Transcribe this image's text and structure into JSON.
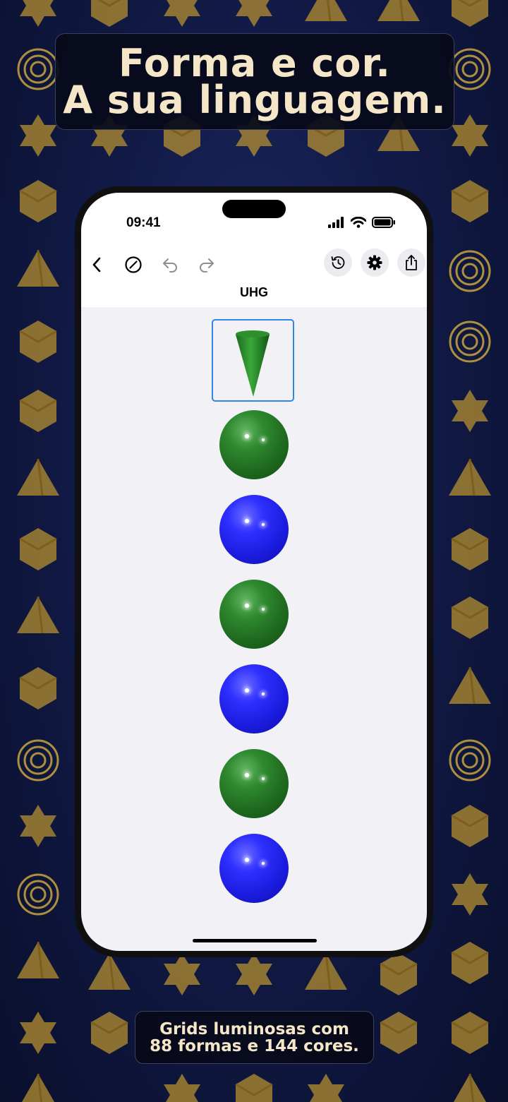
{
  "marketing": {
    "headline_line1": "Forma e cor.",
    "headline_line2": "A sua linguagem.",
    "caption_line1": "Grids luminosas com",
    "caption_line2": "88 formas e 144 cores."
  },
  "status_bar": {
    "time": "09:41",
    "icons": [
      "cellular-signal-icon",
      "wifi-icon",
      "battery-icon"
    ]
  },
  "toolbar": {
    "left_icons": [
      "back-chevron-icon",
      "no-entry-icon",
      "undo-icon",
      "redo-icon"
    ],
    "right_icons": [
      "history-icon",
      "gear-icon",
      "share-icon"
    ],
    "document_title": "UHG"
  },
  "canvas": {
    "items": [
      {
        "shape": "cone",
        "color": "green",
        "selected": true
      },
      {
        "shape": "sphere",
        "color": "green"
      },
      {
        "shape": "sphere",
        "color": "blue"
      },
      {
        "shape": "sphere",
        "color": "green"
      },
      {
        "shape": "sphere",
        "color": "blue"
      },
      {
        "shape": "sphere",
        "color": "green"
      },
      {
        "shape": "sphere",
        "color": "blue"
      }
    ]
  },
  "colors": {
    "accent_selection": "#2f86e6",
    "headline_text": "#f5e6c8",
    "background": "#121b48"
  }
}
